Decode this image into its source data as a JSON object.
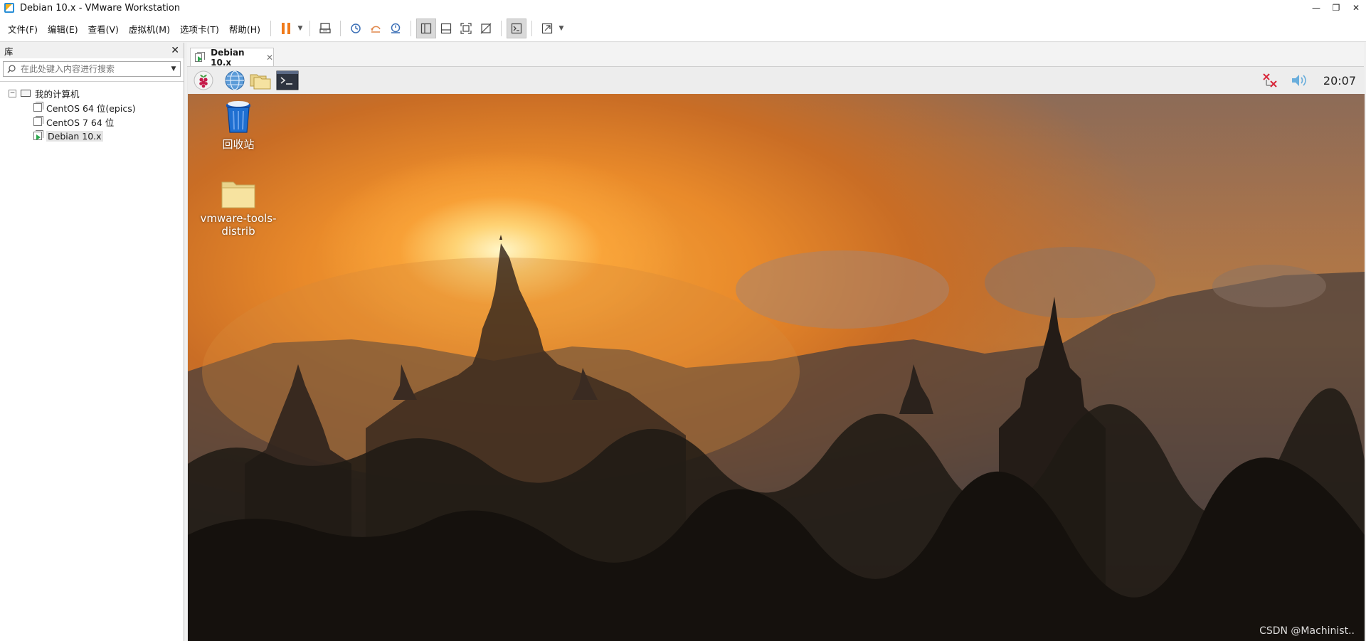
{
  "window": {
    "title": "Debian 10.x - VMware Workstation"
  },
  "menubar": {
    "items": [
      "文件(F)",
      "编辑(E)",
      "查看(V)",
      "虚拟机(M)",
      "选项卡(T)",
      "帮助(H)"
    ]
  },
  "library": {
    "title": "库",
    "search_placeholder": "在此处键入内容进行搜索",
    "root_label": "我的计算机",
    "vms": [
      {
        "label": "CentOS 64 位(epics)"
      },
      {
        "label": "CentOS 7 64 位"
      },
      {
        "label": "Debian 10.x"
      }
    ]
  },
  "tab": {
    "label": "Debian 10.x"
  },
  "guest": {
    "clock": "20:07",
    "desktop_icons": [
      {
        "label": "回收站"
      },
      {
        "label": "vmware-tools-distrib"
      }
    ]
  },
  "watermark": "CSDN @Machinist..",
  "colors": {
    "pause_accent": "#f07a1a",
    "recycle_bin_blue": "#1f6fd1",
    "folder_yellow": "#f7e3a0"
  }
}
